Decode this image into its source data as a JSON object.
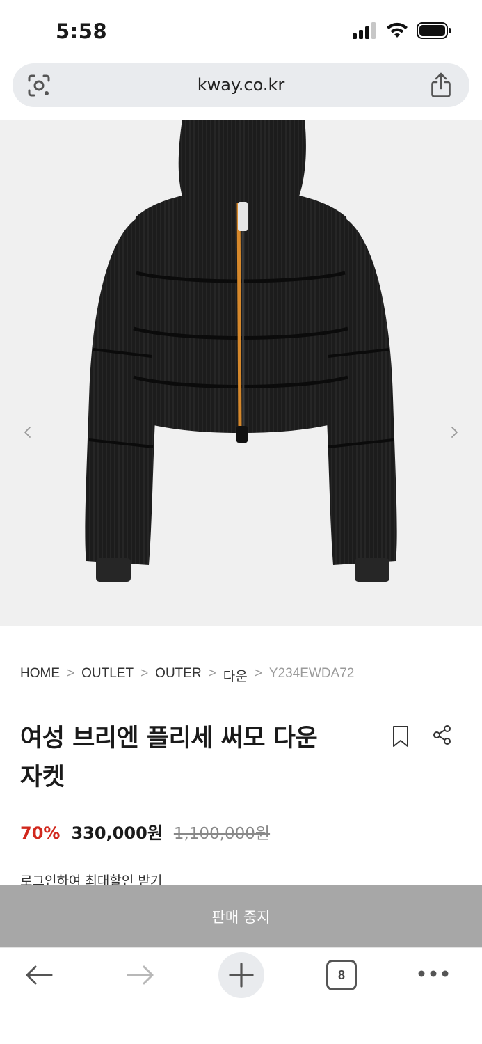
{
  "status": {
    "time": "5:58"
  },
  "browser": {
    "url": "kway.co.kr",
    "tab_count": "8"
  },
  "breadcrumb": {
    "items": [
      "HOME",
      "OUTLET",
      "OUTER",
      "다운"
    ],
    "separator": ">",
    "code": "Y234EWDA72"
  },
  "product": {
    "title": "여성 브리엔 플리세 써모 다운 자켓",
    "discount": "70%",
    "price": "330,000원",
    "original_price": "1,100,000원",
    "login_hint": "로그인하여 최대할인 받기",
    "sale_status": "판매 중지"
  },
  "icons": {
    "lens": "camera-lens-icon",
    "share": "share-icon",
    "bookmark": "bookmark-icon",
    "back": "back-arrow-icon",
    "forward": "forward-arrow-icon",
    "new_tab": "plus-icon",
    "more": "more-icon"
  },
  "colors": {
    "discount": "#d1281d",
    "sale_bar": "#a7a7a7",
    "url_bar": "#e9ebee",
    "gallery_bg": "#f0f0f0"
  }
}
